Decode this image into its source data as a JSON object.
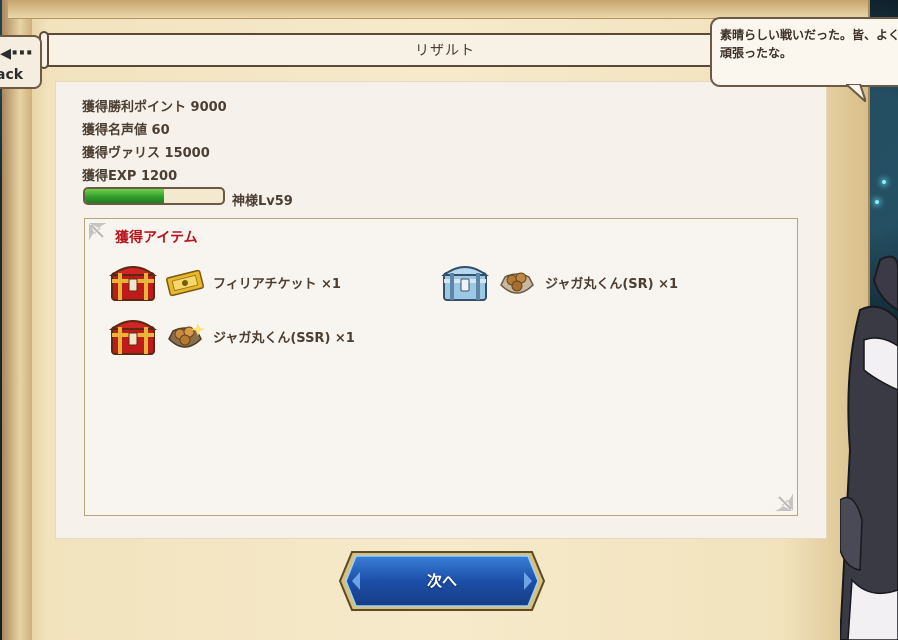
{
  "header": {
    "title": "リザルト",
    "back_label": "ack"
  },
  "rewards": {
    "victory_points": "獲得勝利ポイント 9000",
    "fame": "獲得名声値 60",
    "valis": "獲得ヴァリス 15000",
    "exp": "獲得EXP 1200",
    "exp_progress": 0.57,
    "level_label": "神様Lv59"
  },
  "items_section": {
    "heading": "獲得アイテム",
    "items": [
      {
        "label": "フィリアチケット ×1",
        "chest": "red-chest-icon",
        "thumb": "ticket-icon"
      },
      {
        "label": "ジャガ丸くん(SR) ×1",
        "chest": "blue-chest-icon",
        "thumb": "potato-icon"
      },
      {
        "label": "ジャガ丸くん(SSR) ×1",
        "chest": "red-chest-icon",
        "thumb": "potato-icon"
      }
    ]
  },
  "next_button": {
    "label": "次へ"
  },
  "speech": {
    "text": "素晴らしい戦いだった。皆、よく頑張ったな。"
  },
  "colors": {
    "heading_red": "#b8141b",
    "exp_green": "#2e9a2b",
    "button_blue": "#1d4fa8",
    "parchment": "#f2e3bd"
  }
}
